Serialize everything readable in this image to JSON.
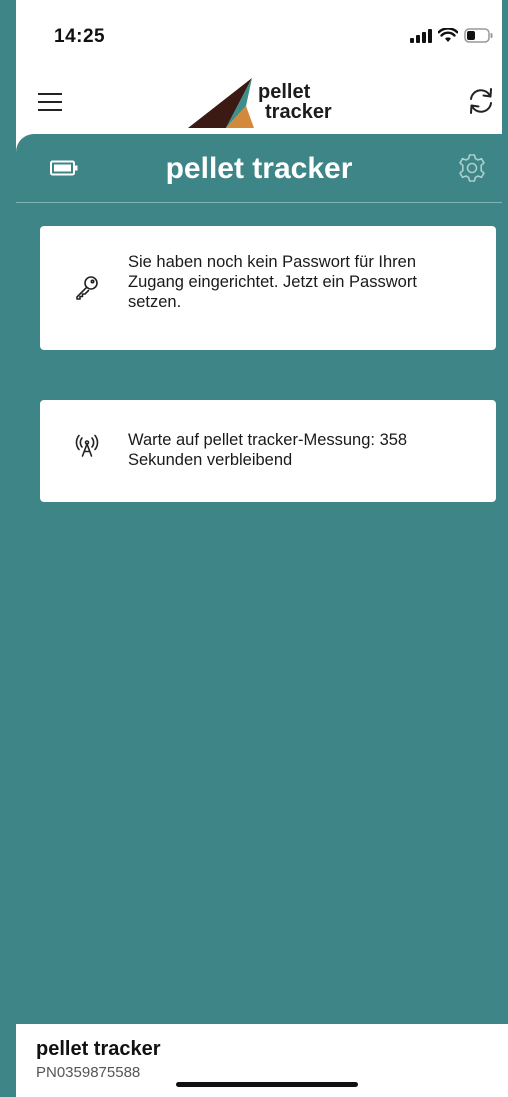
{
  "status_bar": {
    "time": "14:25"
  },
  "app_bar": {
    "logo_line1": "pellet",
    "logo_line2": "tracker",
    "menu_icon": "hamburger-menu-icon",
    "refresh_icon": "refresh-icon"
  },
  "panel": {
    "title": "pellet tracker",
    "battery_icon": "battery-icon",
    "settings_icon": "gear-icon"
  },
  "cards": [
    {
      "icon": "key-icon",
      "text": "Sie haben noch kein Passwort für Ihren Zugang eingerichtet. Jetzt ein Passwort setzen."
    },
    {
      "icon": "antenna-signal-icon",
      "text": "Warte auf pellet tracker-Messung: 358 Sekunden verbleibend"
    }
  ],
  "device": {
    "name": "pellet tracker",
    "id": "PN0359875588"
  },
  "colors": {
    "teal": "#3e8587",
    "logo_dark": "#3a1a12",
    "logo_teal": "#3e8e8a",
    "logo_orange": "#d4893a"
  }
}
